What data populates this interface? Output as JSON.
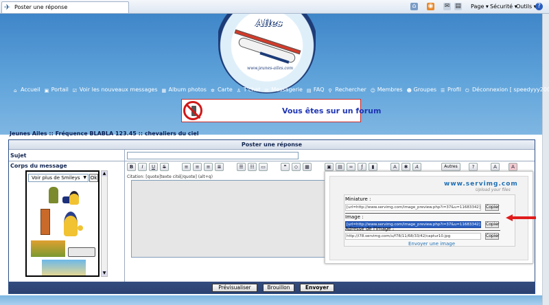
{
  "browser": {
    "tab_title": "Poster une réponse",
    "menu_page": "Page ▾",
    "menu_securite": "Sécurité ▾",
    "menu_outils": "Outils ▾"
  },
  "logo": {
    "title": "Ailes",
    "url": "www.jeunes-ailes.com"
  },
  "nav": {
    "items": [
      {
        "label": "Accueil",
        "icon": "home-icon"
      },
      {
        "label": "Portail",
        "icon": "portal-icon"
      },
      {
        "label": "Voir les nouveaux messages",
        "icon": "new-messages-icon"
      },
      {
        "label": "Album photos",
        "icon": "album-icon"
      },
      {
        "label": "Carte",
        "icon": "map-icon"
      },
      {
        "label": "T'chat",
        "icon": "chat-icon"
      },
      {
        "label": "Messagerie",
        "icon": "mail-icon"
      },
      {
        "label": "FAQ",
        "icon": "faq-icon"
      },
      {
        "label": "Rechercher",
        "icon": "search-icon"
      },
      {
        "label": "Membres",
        "icon": "members-icon"
      },
      {
        "label": "Groupes",
        "icon": "groups-icon"
      },
      {
        "label": "Profil",
        "icon": "profile-icon"
      },
      {
        "label": "Déconnexion [ speedyyy2006 ]",
        "icon": "logout-icon"
      }
    ]
  },
  "banner": {
    "text": "Vous êtes sur un forum"
  },
  "breadcrumb": "Jeunes Ailes :: Fréquence BLABLA 123.45 :: chevaliers du ciel",
  "form": {
    "title": "Poster une réponse",
    "subject_label": "Sujet",
    "body_label": "Corps du message",
    "smiley_select": "Voir plus de Smileys",
    "smiley_ok": "Ok",
    "hint": "Citation: [quote]texte cité[/quote] (alt+q)",
    "tools_autres": "Autres"
  },
  "servimg": {
    "logo_prefix": "www.",
    "logo_main": "servimg.com",
    "tagline": "Upload your files",
    "miniature_label": "Miniature :",
    "miniature_value": "[url=http://www.servimg.com/image_preview.php?i=37&u=11683342][img",
    "image_label": "Image :",
    "image_value": "[url=http://www.servimg.com/image_preview.php?i=37&u=11683342][img",
    "address_label": "Adresse de l'image :",
    "address_value": "http://i78.servimg.com/u/f78/11/68/33/42/captur10.jpg",
    "copier": "Copier",
    "send_image": "Envoyer une image"
  },
  "footer": {
    "preview": "Prévisualiser",
    "draft": "Brouillon",
    "send": "Envoyer"
  },
  "colors": {
    "header_blue": "#4a90d0",
    "form_border": "#2b4d85",
    "arrow_red": "#e01c1c"
  }
}
